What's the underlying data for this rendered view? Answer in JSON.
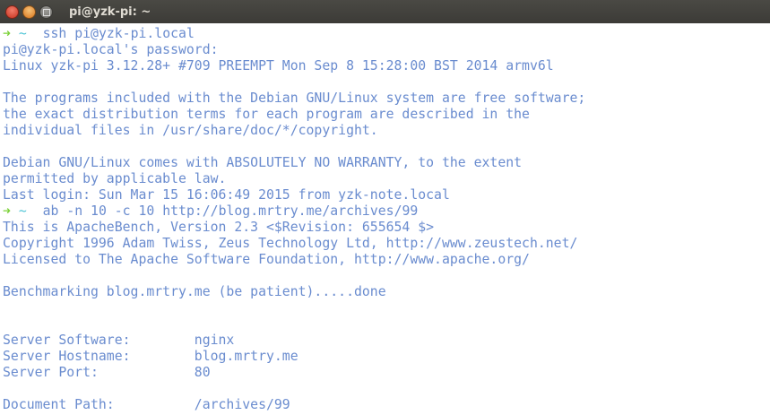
{
  "window": {
    "title": "pi@yzk-pi: ~"
  },
  "prompt": {
    "arrow": "➜",
    "dir": "~"
  },
  "lines": [
    {
      "type": "cmd",
      "text": "ssh pi@yzk-pi.local"
    },
    {
      "text": "pi@yzk-pi.local's password:"
    },
    {
      "text": "Linux yzk-pi 3.12.28+ #709 PREEMPT Mon Sep 8 15:28:00 BST 2014 armv6l"
    },
    {
      "text": ""
    },
    {
      "text": "The programs included with the Debian GNU/Linux system are free software;"
    },
    {
      "text": "the exact distribution terms for each program are described in the"
    },
    {
      "text": "individual files in /usr/share/doc/*/copyright."
    },
    {
      "text": ""
    },
    {
      "text": "Debian GNU/Linux comes with ABSOLUTELY NO WARRANTY, to the extent"
    },
    {
      "text": "permitted by applicable law."
    },
    {
      "text": "Last login: Sun Mar 15 16:06:49 2015 from yzk-note.local"
    },
    {
      "type": "cmd",
      "text": "ab -n 10 -c 10 http://blog.mrtry.me/archives/99"
    },
    {
      "text": "This is ApacheBench, Version 2.3 <$Revision: 655654 $>"
    },
    {
      "text": "Copyright 1996 Adam Twiss, Zeus Technology Ltd, http://www.zeustech.net/"
    },
    {
      "text": "Licensed to The Apache Software Foundation, http://www.apache.org/"
    },
    {
      "text": ""
    },
    {
      "text": "Benchmarking blog.mrtry.me (be patient).....done"
    },
    {
      "text": ""
    },
    {
      "text": ""
    },
    {
      "text": "Server Software:        nginx"
    },
    {
      "text": "Server Hostname:        blog.mrtry.me"
    },
    {
      "text": "Server Port:            80"
    },
    {
      "text": ""
    },
    {
      "text": "Document Path:          /archives/99"
    }
  ]
}
